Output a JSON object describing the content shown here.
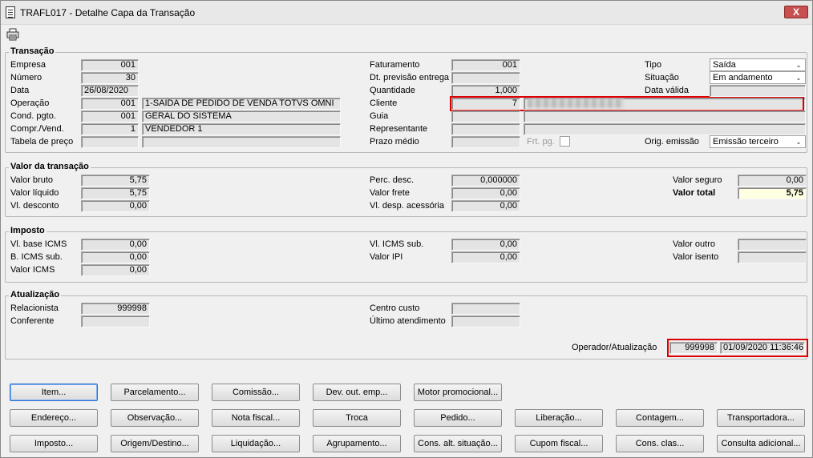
{
  "window": {
    "title": "TRAFL017 - Detalhe Capa da Transação",
    "close_label": "X"
  },
  "transacao": {
    "title": "Transação",
    "empresa_label": "Empresa",
    "empresa": "001",
    "numero_label": "Número",
    "numero": "30",
    "data_label": "Data",
    "data": "26/08/2020",
    "operacao_label": "Operação",
    "operacao_code": "001",
    "operacao_desc": "1-SAIDA DE PEDIDO DE VENDA TOTVS OMNI",
    "cond_label": "Cond. pgto.",
    "cond_code": "001",
    "cond_desc": "GERAL DO SISTEMA",
    "compr_label": "Compr./Vend.",
    "compr_code": "1",
    "compr_desc": "VENDEDOR 1",
    "tabela_label": "Tabela de preço",
    "tabela": "",
    "tabela_desc": "",
    "faturamento_label": "Faturamento",
    "faturamento": "001",
    "dt_prev_label": "Dt. previsão entrega",
    "dt_prev": "",
    "quantidade_label": "Quantidade",
    "quantidade": "1,000",
    "cliente_label": "Cliente",
    "cliente_code": "7",
    "guia_label": "Guia",
    "guia": "",
    "representante_label": "Representante",
    "representante": "",
    "prazo_label": "Prazo médio",
    "prazo": "",
    "frt_label": "Frt. pg.",
    "tipo_label": "Tipo",
    "tipo": "Saída",
    "situacao_label": "Situação",
    "situacao": "Em andamento",
    "data_valida_label": "Data válida",
    "data_valida": "",
    "orig_label": "Orig. emissão",
    "orig": "Emissão terceiro"
  },
  "valor": {
    "title": "Valor da transação",
    "bruto_label": "Valor bruto",
    "bruto": "5,75",
    "liquido_label": "Valor líquido",
    "liquido": "5,75",
    "desconto_label": "Vl. desconto",
    "desconto": "0,00",
    "perc_label": "Perc. desc.",
    "perc": "0,000000",
    "frete_label": "Valor frete",
    "frete": "0,00",
    "desp_label": "Vl. desp. acessória",
    "desp": "0,00",
    "seguro_label": "Valor seguro",
    "seguro": "0,00",
    "total_label": "Valor total",
    "total": "5,75"
  },
  "imposto": {
    "title": "Imposto",
    "base_icms_label": "Vl. base ICMS",
    "base_icms": "0,00",
    "b_icms_sub_label": "B. ICMS sub.",
    "b_icms_sub": "0,00",
    "icms_label": "Valor ICMS",
    "icms": "0,00",
    "vl_icms_sub_label": "Vl. ICMS sub.",
    "vl_icms_sub": "0,00",
    "ipi_label": "Valor IPI",
    "ipi": "0,00",
    "outro_label": "Valor outro",
    "outro": "",
    "isento_label": "Valor isento",
    "isento": ""
  },
  "atualizacao": {
    "title": "Atualização",
    "relacionista_label": "Relacionista",
    "relacionista": "999998",
    "conferente_label": "Conferente",
    "conferente": "",
    "centro_label": "Centro custo",
    "centro": "",
    "ultimo_label": "Último atendimento",
    "ultimo": "",
    "operador_label": "Operador/Atualização",
    "operador": "999998",
    "data_atualizacao": "01/09/2020 11:36:46"
  },
  "buttons": {
    "row1": [
      "Item...",
      "Parcelamento...",
      "Comissão...",
      "Dev. out. emp...",
      "Motor promocional..."
    ],
    "row2": [
      "Endereço...",
      "Observação...",
      "Nota fiscal...",
      "Troca",
      "Pedido...",
      "Liberação...",
      "Contagem...",
      "Transportadora..."
    ],
    "row3": [
      "Imposto...",
      "Origem/Destino...",
      "Liquidação...",
      "Agrupamento...",
      "Cons. alt. situação...",
      "Cupom fiscal...",
      "Cons. clas...",
      "Consulta adicional..."
    ]
  },
  "icons": {
    "print": "printer-icon",
    "window": "document-icon",
    "dropdown": "chevron-down-icon"
  }
}
